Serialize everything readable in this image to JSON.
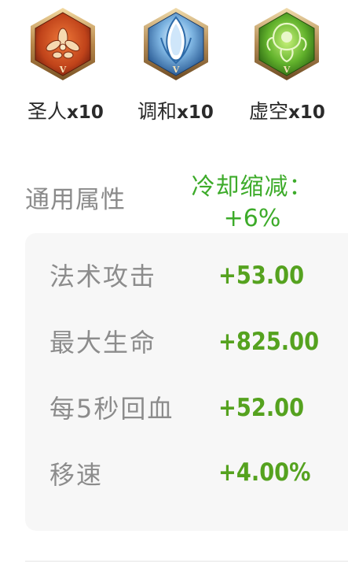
{
  "emblems": [
    {
      "name": "圣人",
      "count": "x10",
      "tier": "V",
      "icon": "saint-emblem-icon",
      "color": "#c2481c"
    },
    {
      "name": "调和",
      "count": "x10",
      "tier": "V",
      "icon": "harmony-emblem-icon",
      "color": "#3f78b5"
    },
    {
      "name": "虚空",
      "count": "x10",
      "tier": "V",
      "icon": "void-emblem-icon",
      "color": "#5fae2a"
    }
  ],
  "section": {
    "title": "通用属性",
    "cooldown_label": "冷却缩减：",
    "cooldown_value": "+6%"
  },
  "stats": [
    {
      "label": "法术攻击",
      "value": "+53.00"
    },
    {
      "label": "最大生命",
      "value": "+825.00"
    },
    {
      "label": "每5秒回血",
      "value": "+52.00"
    },
    {
      "label": "移速",
      "value": "+4.00%"
    }
  ],
  "colors": {
    "accent_green": "#55a21f",
    "cooldown_green": "#3dab2a",
    "label_gray": "#8c8c8c",
    "panel_bg": "#f7f7f7"
  }
}
